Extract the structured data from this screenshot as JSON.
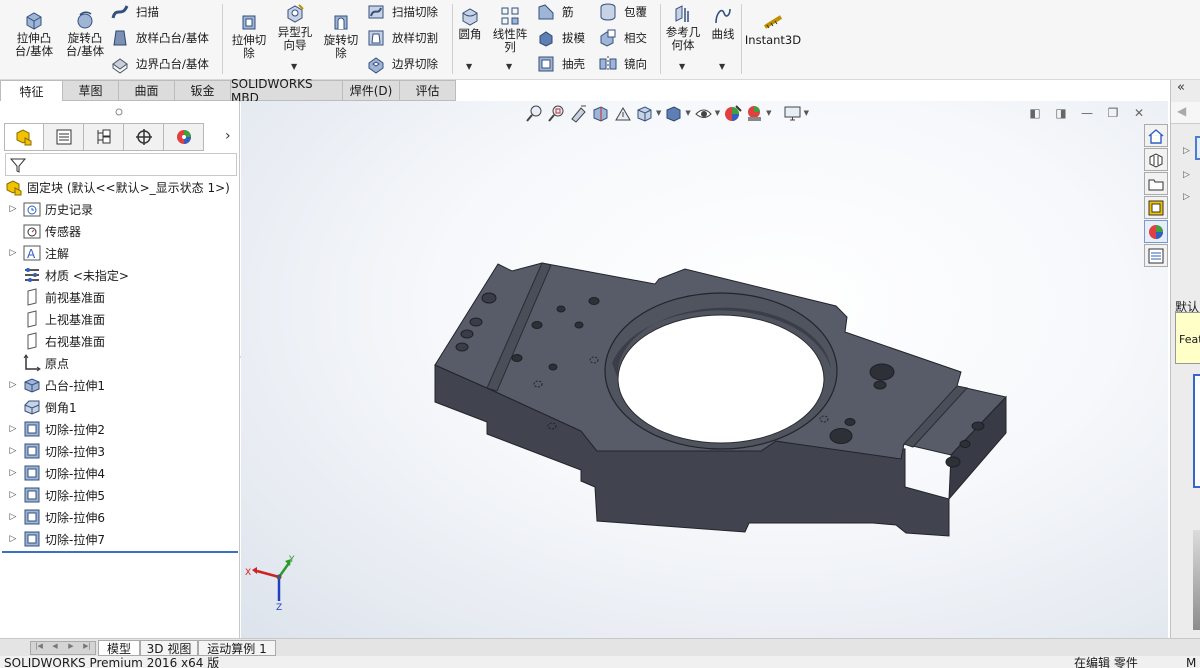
{
  "ribbon": {
    "extrude_boss": "拉伸凸台/基体",
    "revolve_boss": "旋转凸台/基体",
    "sweep": "扫描",
    "loft_boss": "放样凸台/基体",
    "boundary_boss": "边界凸台/基体",
    "extrude_cut": "拉伸切除",
    "hole_wizard": "异型孔向导",
    "revolve_cut": "旋转切除",
    "sweep_cut": "扫描切除",
    "loft_cut": "放样切割",
    "boundary_cut": "边界切除",
    "fillet": "圆角",
    "linear_pattern": "线性阵列",
    "rib": "筋",
    "draft": "拔模",
    "shell": "抽壳",
    "wrap": "包覆",
    "intersect": "相交",
    "mirror": "镜向",
    "ref_geometry": "参考几何体",
    "curves": "曲线",
    "instant3d": "Instant3D"
  },
  "tabs": [
    "特征",
    "草图",
    "曲面",
    "钣金",
    "SOLIDWORKS MBD",
    "焊件(D)",
    "评估"
  ],
  "tree": {
    "root": "固定块 (默认<<默认>_显示状态 1>)",
    "items": [
      {
        "label": "历史记录",
        "expand": true
      },
      {
        "label": "传感器",
        "expand": false
      },
      {
        "label": "注解",
        "expand": true
      },
      {
        "label": "材质 <未指定>",
        "expand": false
      },
      {
        "label": "前视基准面",
        "expand": false
      },
      {
        "label": "上视基准面",
        "expand": false
      },
      {
        "label": "右视基准面",
        "expand": false
      },
      {
        "label": "原点",
        "expand": false
      },
      {
        "label": "凸台-拉伸1",
        "expand": true
      },
      {
        "label": "倒角1",
        "expand": false
      },
      {
        "label": "切除-拉伸2",
        "expand": true
      },
      {
        "label": "切除-拉伸3",
        "expand": true
      },
      {
        "label": "切除-拉伸4",
        "expand": true
      },
      {
        "label": "切除-拉伸5",
        "expand": true
      },
      {
        "label": "切除-拉伸6",
        "expand": true
      },
      {
        "label": "切除-拉伸7",
        "expand": true
      }
    ]
  },
  "triad": {
    "x": "X",
    "y": "Y",
    "z": "Z"
  },
  "bottom_tabs": [
    "模型",
    "3D 视图",
    "运动算例 1"
  ],
  "status": {
    "product": "SOLIDWORKS Premium 2016 x64 版",
    "editing": "在编辑 零件",
    "right_edge": "M"
  },
  "right_panel": {
    "default_text": "默认",
    "feature_text": "Feat"
  },
  "colors": {
    "part_top": "#585c68",
    "part_side": "#41444f",
    "accent": "#f2c200",
    "tree_line": "#3d6fc4"
  }
}
